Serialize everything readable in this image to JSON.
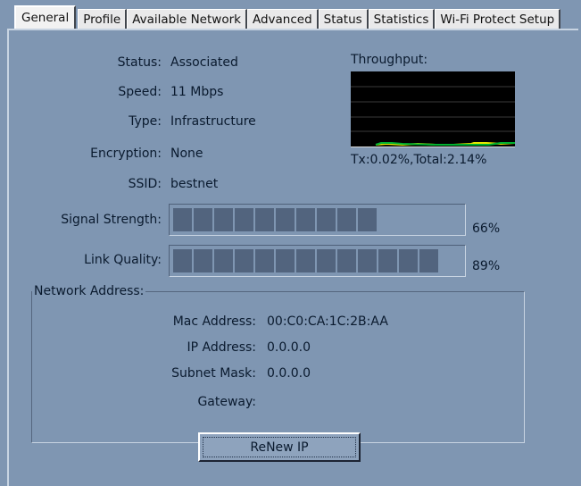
{
  "tabs": [
    {
      "label": "General",
      "active": true
    },
    {
      "label": "Profile",
      "active": false
    },
    {
      "label": "Available Network",
      "active": false
    },
    {
      "label": "Advanced",
      "active": false
    },
    {
      "label": "Status",
      "active": false
    },
    {
      "label": "Statistics",
      "active": false
    },
    {
      "label": "Wi-Fi Protect Setup",
      "active": false
    }
  ],
  "status": {
    "status_label": "Status:",
    "status_value": "Associated",
    "speed_label": "Speed:",
    "speed_value": "11 Mbps",
    "type_label": "Type:",
    "type_value": "Infrastructure",
    "encryption_label": "Encryption:",
    "encryption_value": "None",
    "ssid_label": "SSID:",
    "ssid_value": "bestnet"
  },
  "throughput": {
    "title": "Throughput:",
    "summary": "Tx:0.02%,Total:2.14%"
  },
  "signal": {
    "label": "Signal Strength:",
    "percent_text": "66%",
    "percent": 66,
    "filled_segments": 10
  },
  "link": {
    "label": "Link Quality:",
    "percent_text": "89%",
    "percent": 89,
    "filled_segments": 13
  },
  "network_address": {
    "title": "Network Address:",
    "mac_label": "Mac Address:",
    "mac_value": "00:C0:CA:1C:2B:AA",
    "ip_label": "IP Address:",
    "ip_value": "0.0.0.0",
    "subnet_label": "Subnet Mask:",
    "subnet_value": "0.0.0.0",
    "gateway_label": "Gateway:",
    "gateway_value": ""
  },
  "renew_button": {
    "label": "ReNew IP"
  },
  "colors": {
    "background": "#7f96b2",
    "meter_segment": "#52647e",
    "graph_background": "#000000",
    "graph_total_line": "#e8e800",
    "graph_tx_line": "#00b030"
  }
}
